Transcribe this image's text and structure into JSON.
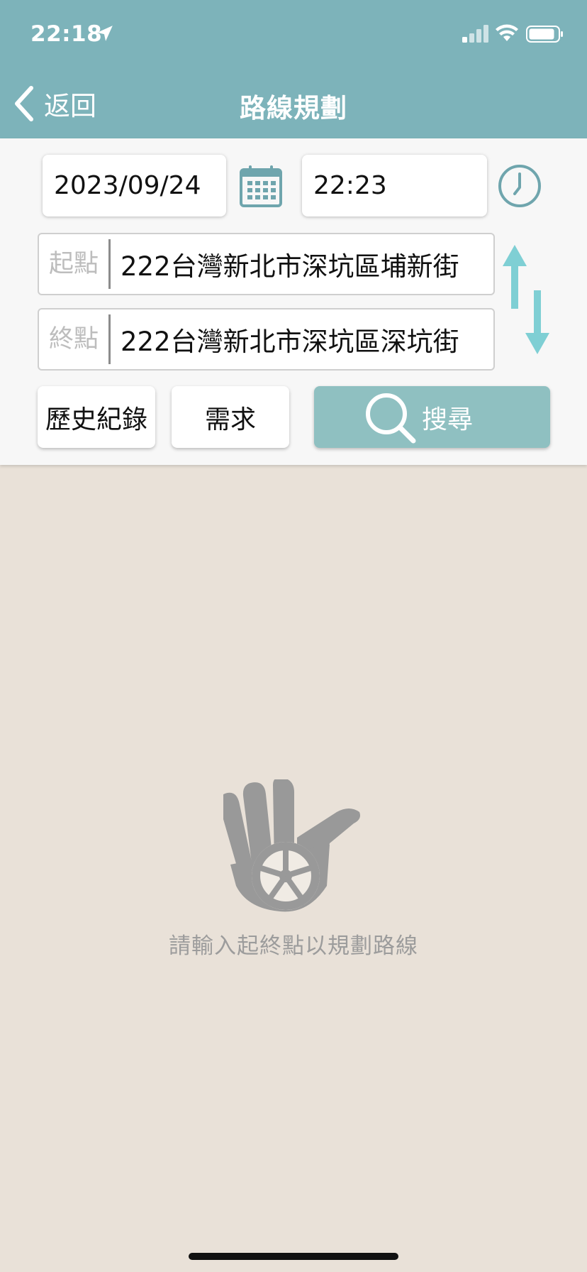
{
  "status_bar": {
    "time": "22:18",
    "location_icon": "location-arrow-icon",
    "signal_icon": "cellular-signal-icon",
    "wifi_icon": "wifi-icon",
    "battery_icon": "battery-icon"
  },
  "nav": {
    "back_label": "返回",
    "back_icon": "chevron-left-icon",
    "title": "路線規劃"
  },
  "form": {
    "date": "2023/09/24",
    "date_icon": "calendar-icon",
    "time": "22:23",
    "time_icon": "clock-icon",
    "start_label": "起點",
    "start_value": "222台灣新北市深坑區埔新街",
    "end_label": "終點",
    "end_value": "222台灣新北市深坑區深坑街",
    "swap_icon": "swap-arrows-icon"
  },
  "buttons": {
    "history": "歷史紀錄",
    "demand": "需求",
    "search": "搜尋",
    "search_icon": "search-icon"
  },
  "empty_state": {
    "icon": "hand-wheel-icon",
    "message": "請輸入起終點以規劃路線"
  },
  "colors": {
    "header": "#7db3ba",
    "accent_icon": "#6fa5ad",
    "swap_arrow": "#7fcfd4",
    "search_button": "#8fc0c1",
    "background": "#e9e1d8",
    "panel": "#f7f7f7"
  }
}
